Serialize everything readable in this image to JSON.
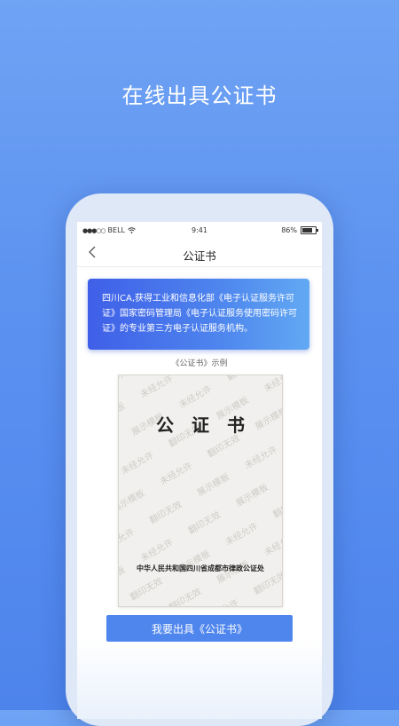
{
  "headline": "在线出具公证书",
  "status_bar": {
    "carrier": "BELL",
    "time": "9:41",
    "battery": "86%"
  },
  "nav": {
    "title": "公证书"
  },
  "info_banner": {
    "text": "四川CA,获得工业和信息化部《电子认证服务许可证》国家密码管理局《电子认证服务使用密码许可证》的专业第三方电子认证服务机构。"
  },
  "sample_caption": "《公证书》示例",
  "certificate": {
    "title": "公证书",
    "issuer": "中华人民共和国四川省成都市律政公证处",
    "watermarks": [
      "展示模板",
      "未经允许",
      "翻印无效"
    ]
  },
  "action_button": {
    "label": "我要出具《公证书》"
  },
  "colors": {
    "background_top": "#6fa3f4",
    "background_bottom": "#4d84ec",
    "button": "#4f86ee",
    "banner_start": "#3f5fe8",
    "banner_end": "#62a9f3"
  }
}
